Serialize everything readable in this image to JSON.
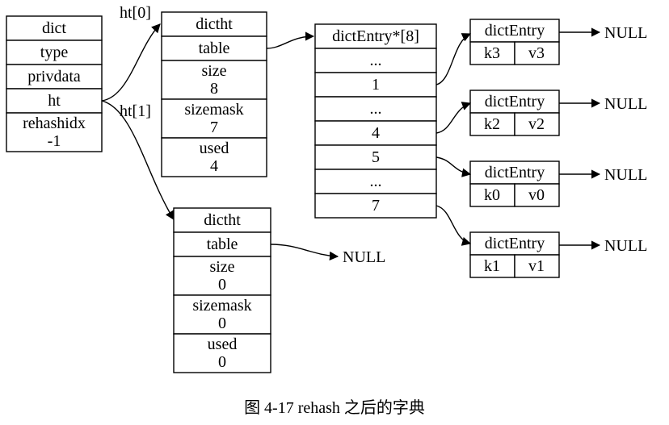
{
  "dict": {
    "title": "dict",
    "fields": [
      "type",
      "privdata",
      "ht"
    ],
    "rehash_label": "rehashidx",
    "rehash_value": "-1"
  },
  "ht_labels": [
    "ht[0]",
    "ht[1]"
  ],
  "dictht0": {
    "title": "dictht",
    "table_label": "table",
    "size_label": "size",
    "size_value": "8",
    "sizemask_label": "sizemask",
    "sizemask_value": "7",
    "used_label": "used",
    "used_value": "4"
  },
  "dictht1": {
    "title": "dictht",
    "table_label": "table",
    "size_label": "size",
    "size_value": "0",
    "sizemask_label": "sizemask",
    "sizemask_value": "0",
    "used_label": "used",
    "used_value": "0"
  },
  "ht1_table_target": "NULL",
  "bucket": {
    "header": "dictEntry*[8]",
    "rows": [
      "...",
      "1",
      "...",
      "4",
      "5",
      "...",
      "7"
    ]
  },
  "entries": [
    {
      "title": "dictEntry",
      "key": "k3",
      "val": "v3",
      "next": "NULL"
    },
    {
      "title": "dictEntry",
      "key": "k2",
      "val": "v2",
      "next": "NULL"
    },
    {
      "title": "dictEntry",
      "key": "k0",
      "val": "v0",
      "next": "NULL"
    },
    {
      "title": "dictEntry",
      "key": "k1",
      "val": "v1",
      "next": "NULL"
    }
  ],
  "caption": "图 4-17    rehash 之后的字典"
}
